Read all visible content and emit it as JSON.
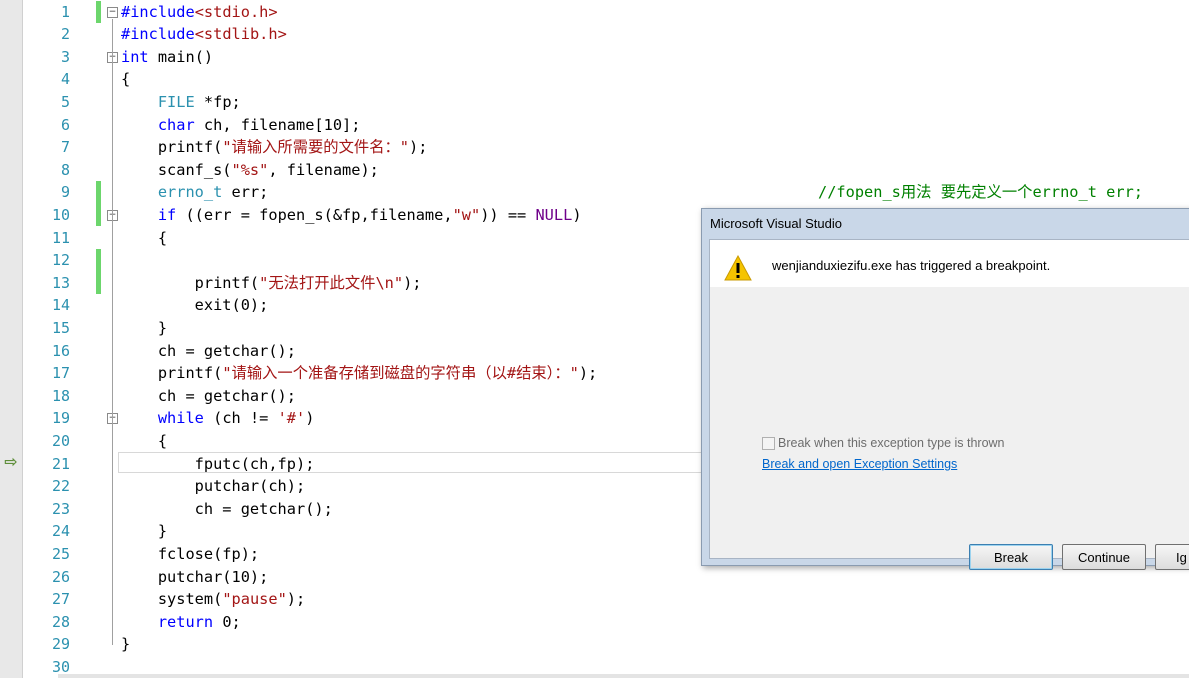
{
  "editor": {
    "lines": [
      {
        "num": "1",
        "tokens": [
          [
            "kw",
            "#include"
          ],
          [
            "str",
            "<stdio.h>"
          ]
        ]
      },
      {
        "num": "2",
        "tokens": [
          [
            "kw",
            "#include"
          ],
          [
            "str",
            "<stdlib.h>"
          ]
        ]
      },
      {
        "num": "3",
        "tokens": [
          [
            "kw",
            "int"
          ],
          [
            "",
            " main()"
          ]
        ]
      },
      {
        "num": "4",
        "tokens": [
          [
            "",
            "{"
          ]
        ]
      },
      {
        "num": "5",
        "tokens": [
          [
            "",
            "    "
          ],
          [
            "ty",
            "FILE"
          ],
          [
            "",
            " *fp;"
          ]
        ]
      },
      {
        "num": "6",
        "tokens": [
          [
            "",
            "    "
          ],
          [
            "kw",
            "char"
          ],
          [
            "",
            " ch, filename[10];"
          ]
        ]
      },
      {
        "num": "7",
        "tokens": [
          [
            "",
            "    printf("
          ],
          [
            "str",
            "\"请输入所需要的文件名：\""
          ],
          [
            "",
            ");"
          ]
        ]
      },
      {
        "num": "8",
        "tokens": [
          [
            "",
            "    scanf_s("
          ],
          [
            "str",
            "\"%s\""
          ],
          [
            "",
            ", filename);"
          ]
        ]
      },
      {
        "num": "9",
        "tokens": [
          [
            "",
            "    "
          ],
          [
            "ty",
            "errno_t"
          ],
          [
            "",
            " err;"
          ]
        ]
      },
      {
        "num": "10",
        "tokens": [
          [
            "",
            "    "
          ],
          [
            "kw",
            "if"
          ],
          [
            "",
            " ((err = fopen_s(&fp,filename,"
          ],
          [
            "str",
            "\"w\""
          ],
          [
            "",
            ")) == "
          ],
          [
            "mac",
            "NULL"
          ],
          [
            "",
            ")"
          ]
        ]
      },
      {
        "num": "11",
        "tokens": [
          [
            "",
            "    {"
          ]
        ]
      },
      {
        "num": "12",
        "tokens": [
          [
            "",
            ""
          ]
        ]
      },
      {
        "num": "13",
        "tokens": [
          [
            "",
            "        printf("
          ],
          [
            "str",
            "\"无法打开此文件\\n\""
          ],
          [
            "",
            ");"
          ]
        ]
      },
      {
        "num": "14",
        "tokens": [
          [
            "",
            "        exit(0);"
          ]
        ]
      },
      {
        "num": "15",
        "tokens": [
          [
            "",
            "    }"
          ]
        ]
      },
      {
        "num": "16",
        "tokens": [
          [
            "",
            "    ch = getchar();"
          ]
        ]
      },
      {
        "num": "17",
        "tokens": [
          [
            "",
            "    printf("
          ],
          [
            "str",
            "\"请输入一个准备存储到磁盘的字符串（以#结束）：\""
          ],
          [
            "",
            ");"
          ]
        ]
      },
      {
        "num": "18",
        "tokens": [
          [
            "",
            "    ch = getchar();"
          ]
        ]
      },
      {
        "num": "19",
        "tokens": [
          [
            "",
            "    "
          ],
          [
            "kw",
            "while"
          ],
          [
            "",
            " (ch != "
          ],
          [
            "str",
            "'#'"
          ],
          [
            "",
            ")"
          ]
        ]
      },
      {
        "num": "20",
        "tokens": [
          [
            "",
            "    {"
          ]
        ]
      },
      {
        "num": "21",
        "tokens": [
          [
            "",
            "        fputc(ch,fp);"
          ]
        ]
      },
      {
        "num": "22",
        "tokens": [
          [
            "",
            "        putchar(ch);"
          ]
        ]
      },
      {
        "num": "23",
        "tokens": [
          [
            "",
            "        ch = getchar();"
          ]
        ]
      },
      {
        "num": "24",
        "tokens": [
          [
            "",
            "    }"
          ]
        ]
      },
      {
        "num": "25",
        "tokens": [
          [
            "",
            "    fclose(fp);"
          ]
        ]
      },
      {
        "num": "26",
        "tokens": [
          [
            "",
            "    putchar(10);"
          ]
        ]
      },
      {
        "num": "27",
        "tokens": [
          [
            "",
            "    system("
          ],
          [
            "str",
            "\"pause\""
          ],
          [
            "",
            ");"
          ]
        ]
      },
      {
        "num": "28",
        "tokens": [
          [
            "",
            "    "
          ],
          [
            "kw",
            "return"
          ],
          [
            "",
            " 0;"
          ]
        ]
      },
      {
        "num": "29",
        "tokens": [
          [
            "",
            "}"
          ]
        ]
      },
      {
        "num": "30",
        "tokens": [
          [
            "",
            ""
          ]
        ]
      }
    ],
    "right_comment": "//fopen_s用法 要先定义一个errno_t err;",
    "current_line": "21",
    "changed_lines": [
      "1",
      "9",
      "10",
      "12",
      "13"
    ],
    "folded_lines": [
      "1",
      "3",
      "10",
      "19"
    ]
  },
  "dialog": {
    "title": "Microsoft Visual Studio",
    "message": "wenjianduxiezifu.exe has triggered a breakpoint.",
    "checkbox_label": "Break when this exception type is thrown",
    "checkbox_checked": false,
    "link_text": "Break and open Exception Settings",
    "buttons": {
      "break": "Break",
      "continue": "Continue",
      "ignore": "Ig"
    },
    "icon": "warning-icon"
  },
  "colors": {
    "line_number": "#2b91af",
    "keyword": "#0000ff",
    "type": "#2b91af",
    "string": "#a31515",
    "macro": "#6f008a",
    "comment": "#008000",
    "change_bar": "#6cd66c",
    "link": "#0066cc"
  }
}
